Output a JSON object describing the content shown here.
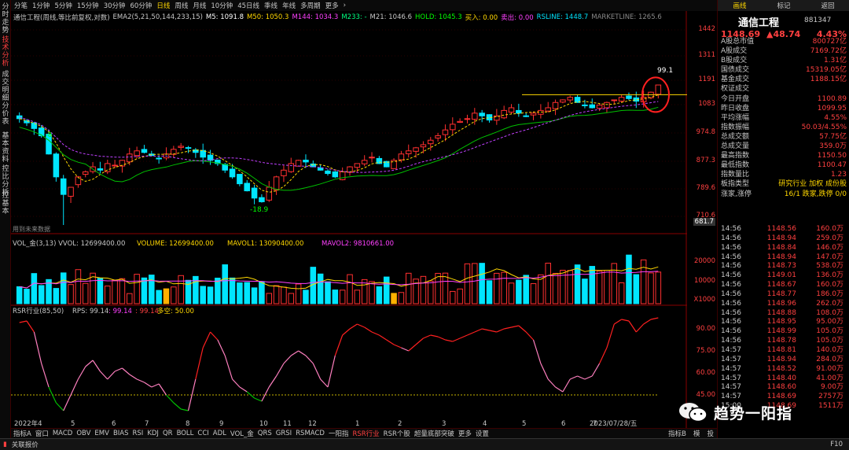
{
  "vtabs": [
    "分时走势",
    "技术分析",
    "成交明细",
    "分价表",
    "基本资料",
    "控比分析",
    "控基本"
  ],
  "topbar": [
    "分笔",
    "1分钟",
    "5分钟",
    "15分钟",
    "30分钟",
    "60分钟",
    "日线",
    "周线",
    "月线",
    "10分钟",
    "45日线",
    "季线",
    "年线",
    "多周期",
    "更多",
    "›"
  ],
  "topbar_active": 6,
  "ind": {
    "title": "通信工程(周线,等比前复权,对数)",
    "ema": "EMA2(5,21,50,144,233,15)",
    "m5": "M5: 1091.8",
    "m50": "M50: 1050.3",
    "m144": "M144: 1034.3",
    "m233": "M233: -",
    "m21": "M21: 1046.6",
    "hold": "HOLD: 1045.3",
    "buy": "买入: 0.00",
    "sell": "卖出: 0.00",
    "rsline": "RSLINE: 1448.7",
    "mkline": "MARKETLINE: 1265.6"
  },
  "price_axis": [
    "1442",
    "1311",
    "1191",
    "1083",
    "974.8",
    "877.3",
    "789.6",
    "710.6"
  ],
  "cursor_price": "681.7",
  "anno": {
    "hi": "99.1",
    "lo": "-18.9",
    "arrow": "-8",
    "future": "用到未来数据"
  },
  "vol": {
    "label": "VOL_金(3,13) VVOL: 12699400.00",
    "volume": "VOLUME: 12699400.00",
    "mavol1": "MAVOL1: 13090400.00",
    "mavol2": "MAVOL2: 9810661.00",
    "axis": [
      "20000",
      "10000"
    ],
    "unit": "X1000"
  },
  "rsr": {
    "label": "RSR行业(85,50)",
    "rps": "RPS: 99.14",
    "v1": ": 99.14",
    "v2": ": 99.14",
    "dk": "多空: 50.00",
    "axis": [
      "90.00",
      "75.00",
      "60.00",
      "45.00"
    ]
  },
  "xaxis": [
    "2022年4",
    "5",
    "6",
    "7",
    "8",
    "9",
    "10",
    "11",
    "12",
    "1",
    "2",
    "3",
    "4",
    "5",
    "6",
    "7",
    "2023/07/28/五"
  ],
  "bottom_tabs": [
    "指标A",
    "窗口",
    "MACD",
    "OBV",
    "EMV",
    "BIAS",
    "RSI",
    "KDJ",
    "QR",
    "BOLL",
    "CCI",
    "ADL",
    "VOL_金",
    "QRS",
    "GRSI",
    "RSMACD",
    "一阳指",
    "RSR行业",
    "RSR个股",
    "超量底部突破",
    "更多",
    "设置"
  ],
  "bottom_active": 17,
  "bottom_right": [
    "指标B",
    "模",
    "投"
  ],
  "status": [
    "▮",
    "关联报价"
  ],
  "status_right": "F10",
  "rtop": [
    "画线",
    "标记",
    "返回"
  ],
  "stock": {
    "name": "通信工程",
    "code": "881347",
    "price": "1148.69",
    "chg": "▲48.74",
    "pct": "4.43%"
  },
  "kv": [
    [
      "A股总市值",
      "800727亿"
    ],
    [
      "A股成交",
      "7169.72亿"
    ],
    [
      "B股成交",
      "1.31亿"
    ],
    [
      "国债成交",
      "15319.05亿"
    ],
    [
      "基金成交",
      "1188.15亿"
    ],
    [
      "权证成交",
      ""
    ],
    [
      "今日开盘",
      "1100.89"
    ],
    [
      "昨日收盘",
      "1099.95"
    ],
    [
      "平均涨幅",
      "4.55%"
    ],
    [
      "指数振幅",
      "50.03/4.55%"
    ],
    [
      "总成交额",
      "57.75亿"
    ],
    [
      "总成交量",
      "359.0万"
    ],
    [
      "最高指数",
      "1150.50"
    ],
    [
      "最低指数",
      "1100.47"
    ],
    [
      "指数量比",
      "1.23"
    ],
    [
      "板指类型",
      "研究行业 加权 成份股"
    ],
    [
      "涨家,涨停",
      "16/1  跌家,跌停  0/0"
    ]
  ],
  "ticks": [
    [
      "14:56",
      "1148.56",
      "160.0万"
    ],
    [
      "14:56",
      "1148.94",
      "259.0万"
    ],
    [
      "14:56",
      "1148.84",
      "146.0万"
    ],
    [
      "14:56",
      "1148.94",
      "147.0万"
    ],
    [
      "14:56",
      "1148.73",
      "538.0万"
    ],
    [
      "14:56",
      "1149.01",
      "136.0万"
    ],
    [
      "14:56",
      "1148.67",
      "160.0万"
    ],
    [
      "14:56",
      "1148.77",
      "186.0万"
    ],
    [
      "14:56",
      "1148.96",
      "262.0万"
    ],
    [
      "14:56",
      "1148.88",
      "108.0万"
    ],
    [
      "14:56",
      "1148.95",
      "95.00万"
    ],
    [
      "14:56",
      "1148.99",
      "105.0万"
    ],
    [
      "14:56",
      "1148.78",
      "105.0万"
    ],
    [
      "14:57",
      "1148.81",
      "140.0万"
    ],
    [
      "14:57",
      "1148.94",
      "284.0万"
    ],
    [
      "14:57",
      "1148.52",
      "91.00万"
    ],
    [
      "14:57",
      "1148.40",
      "41.00万"
    ],
    [
      "14:57",
      "1148.60",
      "9.00万"
    ],
    [
      "14:57",
      "1148.69",
      "2757万"
    ],
    [
      "15:00",
      "1148.69",
      "1511万"
    ]
  ],
  "watermark": "趋势一阳指",
  "colors": {
    "up": "#ff3030",
    "down": "#00e5ff",
    "bg": "#000000",
    "accent": "#ffd700"
  },
  "chart_data": {
    "type": "candlestick",
    "note": "weekly index 2022-04 .. 2023-07",
    "closes": [
      1020,
      1005,
      985,
      960,
      900,
      830,
      780,
      800,
      830,
      845,
      860,
      850,
      870,
      865,
      880,
      900,
      910,
      905,
      895,
      885,
      900,
      915,
      925,
      920,
      905,
      890,
      880,
      870,
      850,
      830,
      810,
      790,
      770,
      760,
      800,
      830,
      850,
      870,
      880,
      875,
      860,
      850,
      840,
      830,
      845,
      860,
      870,
      880,
      890,
      870,
      860,
      880,
      900,
      910,
      920,
      930,
      945,
      960,
      980,
      1000,
      1010,
      1020,
      1040,
      1030,
      1015,
      1030,
      1050,
      1060,
      1040,
      1030,
      1040,
      1050,
      1060,
      1080,
      1090,
      1100,
      1080,
      1070,
      1060,
      1070,
      1080,
      1090,
      1100,
      1095,
      1085,
      1100,
      1120,
      1149
    ]
  }
}
